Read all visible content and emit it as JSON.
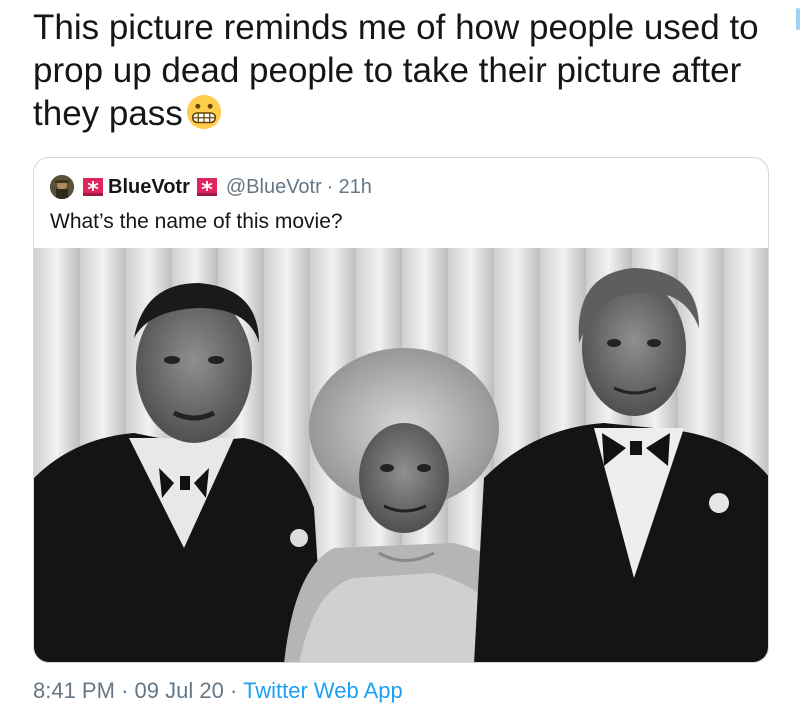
{
  "tweet": {
    "text": "This picture reminds me of how people used to prop up dead people to take their picture after they pass",
    "emoji": "grimacing-face"
  },
  "quoted_tweet": {
    "display_name": "BlueVotr",
    "handle": "@BlueVotr",
    "separator": "·",
    "time": "21h",
    "text": "What’s the name of this movie?",
    "image": "black-and-white photo of two men in tuxedos and an elderly woman between them"
  },
  "footer": {
    "time": "8:41 PM",
    "separator1": "·",
    "date": "09 Jul 20",
    "separator2": "·",
    "source": "Twitter Web App"
  },
  "colors": {
    "text": "#14171a",
    "muted": "#657786",
    "link": "#1da1f2",
    "border": "#cfd9de",
    "siren_red": "#e0245e"
  }
}
